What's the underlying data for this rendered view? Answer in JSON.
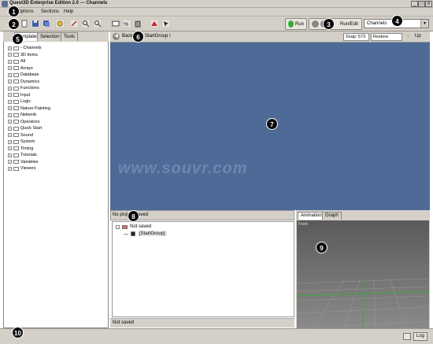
{
  "window": {
    "title": "Quest3D Enterprise Edition 2.0  ---  Channels",
    "controls": [
      "_",
      "□",
      "X"
    ]
  },
  "menu": {
    "items": [
      "Options",
      "Sections",
      "Help"
    ]
  },
  "toolbar": {
    "run_label": "Run",
    "run_edit_label": "Run/Edit",
    "view_select": "Channels",
    "icons": [
      "new-file-icon",
      "open-folder-icon",
      "save-icon",
      "save-all-icon",
      "settings-icon",
      "plug-icon",
      "zoom-in-icon",
      "zoom-out-icon",
      "export-icon",
      "link-icon",
      "delete-icon",
      "camera-icon",
      "pointer-icon"
    ]
  },
  "left_panel": {
    "tabs": [
      "Templates",
      "Selection",
      "Tools"
    ],
    "tree": [
      "- Channels",
      "3D Items",
      "All",
      "Arrays",
      "Database",
      "Dynamics",
      "Functions",
      "Input",
      "Logic",
      "Nature Painting",
      "Network",
      "Operators",
      "Quick Start",
      "Sound",
      "System",
      "Timing",
      "Tutorials",
      "Variables",
      "Viewers"
    ]
  },
  "navbar": {
    "back_label": "Back",
    "path": "StartGroup \\",
    "snap_label": "Snap: 573",
    "restore_label": "Restore",
    "up_label": "Up"
  },
  "canvas": {
    "watermark": "www.souvr.com"
  },
  "project": {
    "header": "No project saved",
    "root_label": "Not saved",
    "child_label": "[StartGroup]",
    "status": "Not saved"
  },
  "right_panel": {
    "tabs": [
      "Animation",
      "Graph"
    ],
    "viewport_label": "Front"
  },
  "bottom": {
    "log_label": "Log"
  },
  "annotations": [
    "1",
    "2",
    "3",
    "4",
    "5",
    "6",
    "7",
    "8",
    "9",
    "10"
  ],
  "colors": {
    "canvas": "#4e6b98",
    "chrome": "#d4d0c8",
    "viewport": "#6a6a6a",
    "grid_green": "#3aa83a"
  }
}
